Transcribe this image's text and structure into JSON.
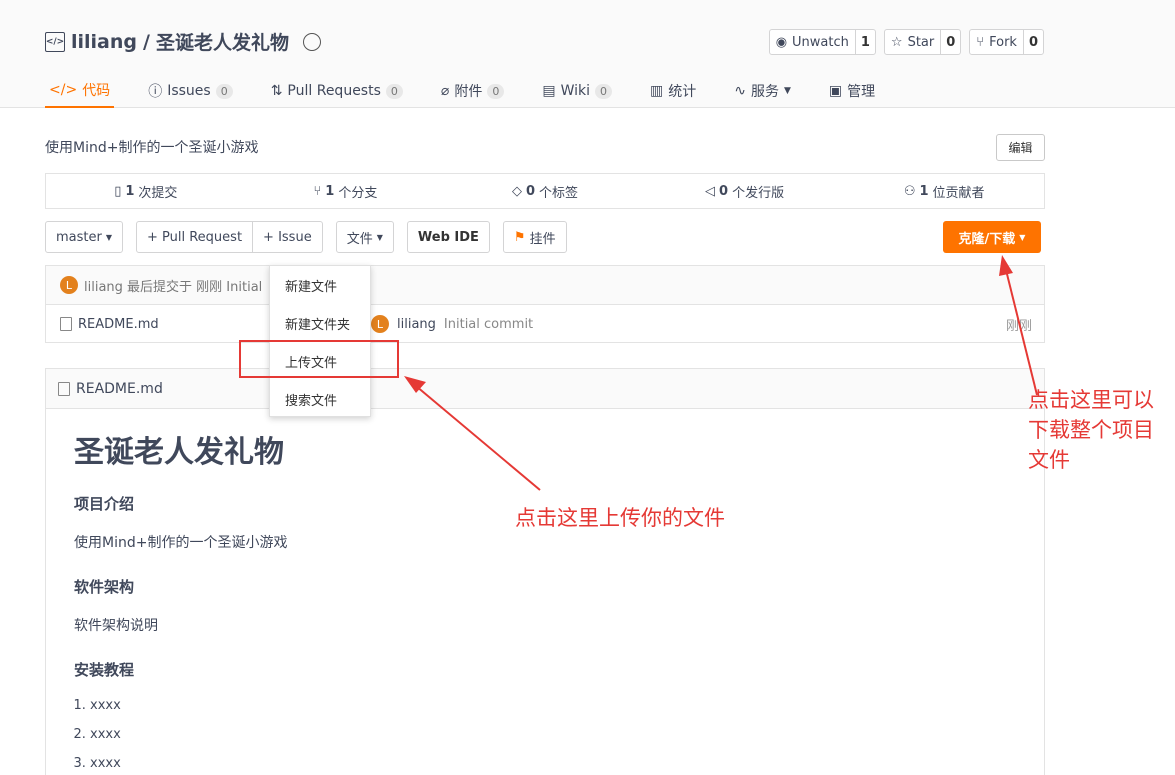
{
  "header": {
    "owner": "liliang",
    "separator": "/",
    "repo_name": "圣诞老人发礼物",
    "actions": [
      {
        "label": "Unwatch",
        "count": "1"
      },
      {
        "label": "Star",
        "count": "0"
      },
      {
        "label": "Fork",
        "count": "0"
      }
    ]
  },
  "tabs": [
    {
      "label": "代码",
      "count": ""
    },
    {
      "label": "Issues",
      "count": "0"
    },
    {
      "label": "Pull Requests",
      "count": "0"
    },
    {
      "label": "附件",
      "count": "0"
    },
    {
      "label": "Wiki",
      "count": "0"
    },
    {
      "label": "统计",
      "count": ""
    },
    {
      "label": "服务",
      "count": ""
    },
    {
      "label": "管理",
      "count": ""
    }
  ],
  "description": "使用Mind+制作的一个圣诞小游戏",
  "edit_label": "编辑",
  "stats": [
    {
      "count": "1",
      "label": "次提交"
    },
    {
      "count": "1",
      "label": "个分支"
    },
    {
      "count": "0",
      "label": "个标签"
    },
    {
      "count": "0",
      "label": "个发行版"
    },
    {
      "count": "1",
      "label": "位贡献者"
    }
  ],
  "toolbar": {
    "branch": "master",
    "pull_request": "+ Pull Request",
    "issue": "+ Issue",
    "files": "文件",
    "web_ide": "Web IDE",
    "widget": "挂件",
    "clone": "克隆/下载"
  },
  "commit_bar": {
    "avatar_letter": "L",
    "text": "liliang 最后提交于 刚刚 Initial"
  },
  "files": [
    {
      "name": "README.md",
      "author_letter": "L",
      "author": "liliang",
      "message": "Initial commit",
      "time": "刚刚"
    }
  ],
  "dropdown": [
    "新建文件",
    "新建文件夹",
    "上传文件",
    "搜索文件"
  ],
  "readme": {
    "filename": "README.md",
    "title": "圣诞老人发礼物",
    "sections": [
      {
        "heading": "项目介绍",
        "text": "使用Mind+制作的一个圣诞小游戏"
      },
      {
        "heading": "软件架构",
        "text": "软件架构说明"
      },
      {
        "heading": "安装教程",
        "text": ""
      }
    ],
    "install_steps": [
      "xxxx",
      "xxxx",
      "xxxx"
    ]
  },
  "annotations": {
    "right": [
      "点击这里可以",
      "下载整个项目",
      "文件"
    ],
    "center": "点击这里上传你的文件"
  },
  "colors": {
    "accent": "#fe7300",
    "annotation": "#e53935"
  }
}
